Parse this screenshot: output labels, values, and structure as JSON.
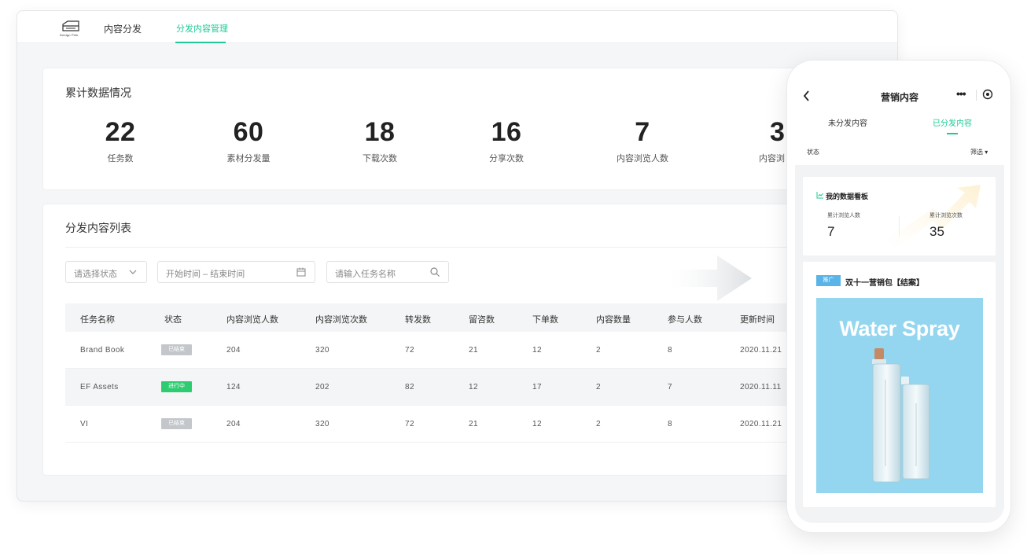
{
  "topbar": {
    "logo_text": "Design Pink",
    "nav": [
      "内容分发",
      "分发内容管理"
    ],
    "active_index": 1
  },
  "stats": {
    "title": "累计数据情况",
    "items": [
      {
        "value": "22",
        "label": "任务数"
      },
      {
        "value": "60",
        "label": "素材分发量"
      },
      {
        "value": "18",
        "label": "下载次数"
      },
      {
        "value": "16",
        "label": "分享次数"
      },
      {
        "value": "7",
        "label": "内容浏览人数"
      },
      {
        "value": "3",
        "label": "内容浏"
      }
    ]
  },
  "list": {
    "title": "分发内容列表",
    "filters": {
      "status_placeholder": "请选择状态",
      "date_placeholder": "开始时间 – 结束时间",
      "name_placeholder": "请输入任务名称"
    },
    "columns": [
      "任务名称",
      "状态",
      "内容浏览人数",
      "内容浏览次数",
      "转发数",
      "留咨数",
      "下单数",
      "内容数量",
      "参与人数",
      "更新时间"
    ],
    "rows": [
      {
        "name": "Brand Book",
        "status": "已结束",
        "status_type": "done",
        "views_people": "204",
        "views_count": "320",
        "forwards": "72",
        "leads": "21",
        "orders": "12",
        "content_count": "2",
        "participants": "8",
        "updated": "2020.11.21"
      },
      {
        "name": "EF Assets",
        "status": "进行中",
        "status_type": "going",
        "views_people": "124",
        "views_count": "202",
        "forwards": "82",
        "leads": "12",
        "orders": "17",
        "content_count": "2",
        "participants": "7",
        "updated": "2020.11.11"
      },
      {
        "name": "VI",
        "status": "已结束",
        "status_type": "done",
        "views_people": "204",
        "views_count": "320",
        "forwards": "72",
        "leads": "21",
        "orders": "12",
        "content_count": "2",
        "participants": "8",
        "updated": "2020.11.21"
      }
    ]
  },
  "phone": {
    "title": "营销内容",
    "tabs": [
      "未分发内容",
      "已分发内容"
    ],
    "active_tab": 1,
    "state_label": "状态",
    "filter_label": "筛选 ▾",
    "dashboard": {
      "title": "我的数据看板",
      "metrics": [
        {
          "label": "累计浏览人数",
          "value": "7"
        },
        {
          "label": "累计浏览次数",
          "value": "35"
        }
      ]
    },
    "promo": {
      "tag": "推广",
      "title": "双十一营销包【结案】",
      "image_title": "Water Spray"
    }
  },
  "colors": {
    "accent": "#20c997",
    "badge_done": "#c3c7cb",
    "badge_going": "#2ecc71",
    "promo_bg": "#94d6ef",
    "tag_blue": "#5ab4e8"
  }
}
